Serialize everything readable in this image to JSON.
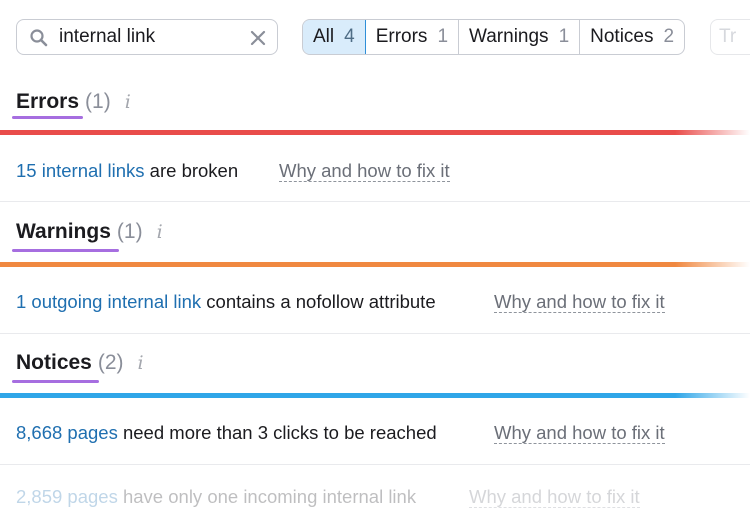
{
  "search": {
    "value": "internal link",
    "placeholder": ""
  },
  "filters": [
    {
      "label": "All",
      "count": "4",
      "active": true
    },
    {
      "label": "Errors",
      "count": "1",
      "active": false
    },
    {
      "label": "Warnings",
      "count": "1",
      "active": false
    },
    {
      "label": "Notices",
      "count": "2",
      "active": false
    }
  ],
  "ghost_button": {
    "label": "Tr"
  },
  "sections": {
    "errors": {
      "title": "Errors",
      "count": "(1)",
      "info": "i",
      "bar_color": "#e94c4a",
      "issues": [
        {
          "link": "15 internal links",
          "rest": " are broken",
          "fix": "Why and how to fix it"
        }
      ]
    },
    "warnings": {
      "title": "Warnings",
      "count": "(1)",
      "info": "i",
      "bar_color": "#f08840",
      "issues": [
        {
          "link": "1 outgoing internal link",
          "rest": " contains a nofollow attribute",
          "fix": "Why and how to fix it"
        }
      ]
    },
    "notices": {
      "title": "Notices",
      "count": "(2)",
      "info": "i",
      "bar_color": "#2fa6e8",
      "issues": [
        {
          "link": "8,668 pages",
          "rest": " need more than 3 clicks to be reached",
          "fix": "Why and how to fix it"
        },
        {
          "link": "2,859 pages",
          "rest": " have only one incoming internal link",
          "fix": "Why and how to fix it"
        }
      ]
    }
  },
  "colors": {
    "accent_underline": "#a66ee0",
    "link": "#1f6fb0",
    "active_filter_bg": "#d9ecfb"
  }
}
